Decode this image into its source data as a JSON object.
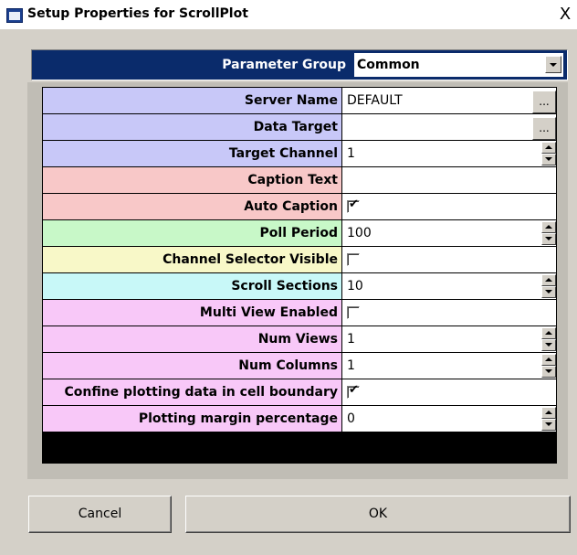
{
  "window": {
    "title": "Setup Properties for ScrollPlot",
    "close_glyph": "X"
  },
  "parameter_group": {
    "label": "Parameter Group",
    "value": "Common"
  },
  "properties": [
    {
      "label": "Server Name",
      "value": "DEFAULT",
      "editor": "ellipsis",
      "color": "#c8c8f8"
    },
    {
      "label": "Data Target",
      "value": "",
      "editor": "ellipsis",
      "color": "#c8c8f8"
    },
    {
      "label": "Target Channel",
      "value": "1",
      "editor": "spin",
      "color": "#c8c8f8"
    },
    {
      "label": "Caption Text",
      "value": "",
      "editor": "text",
      "color": "#f8c8c8"
    },
    {
      "label": "Auto Caption",
      "checked": true,
      "editor": "checkbox",
      "color": "#f8c8c8"
    },
    {
      "label": "Poll Period",
      "value": "100",
      "editor": "spin",
      "color": "#c8f8c8"
    },
    {
      "label": "Channel Selector Visible",
      "checked": false,
      "editor": "checkbox",
      "color": "#f8f8c8"
    },
    {
      "label": "Scroll Sections",
      "value": "10",
      "editor": "spin",
      "color": "#c8f8f8"
    },
    {
      "label": "Multi View Enabled",
      "checked": false,
      "editor": "checkbox",
      "color": "#f8c8f8"
    },
    {
      "label": "Num Views",
      "value": "1",
      "editor": "spin",
      "color": "#f8c8f8"
    },
    {
      "label": "Num Columns",
      "value": "1",
      "editor": "spin",
      "color": "#f8c8f8"
    },
    {
      "label": "Confine plotting data in cell boundary",
      "checked": true,
      "editor": "checkbox",
      "color": "#f8c8f8"
    },
    {
      "label": "Plotting margin percentage",
      "value": "0",
      "editor": "spin",
      "color": "#f8c8f8"
    }
  ],
  "buttons": {
    "cancel": "Cancel",
    "ok": "OK",
    "ellipsis": "..."
  },
  "colors": {
    "header_bg": "#0a2b6b",
    "dialog_bg": "#d4d0c8",
    "group_select_bg": "#ffffff"
  },
  "icons": {
    "title": "window-app-icon",
    "close": "close-icon",
    "dropdown": "chevron-down-icon",
    "spin_up": "spin-up-icon",
    "spin_down": "spin-down-icon",
    "check": "checkmark-icon"
  }
}
